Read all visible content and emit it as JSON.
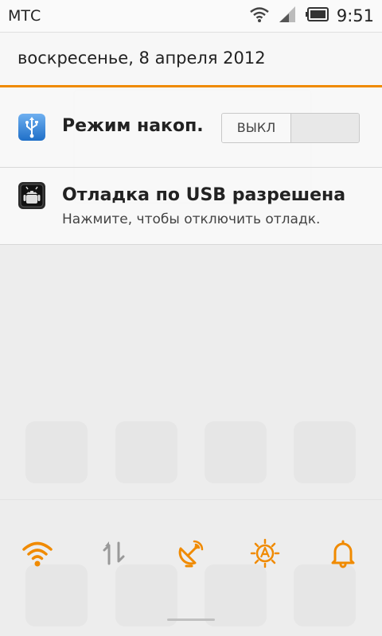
{
  "status_bar": {
    "carrier": "МТС",
    "time": "9:51",
    "icons": [
      "wifi-icon",
      "signal-icon",
      "battery-icon"
    ]
  },
  "shade": {
    "date": "воскресенье, 8 апреля 2012",
    "accent_color": "#f08a00"
  },
  "notifications": [
    {
      "icon": "usb-icon",
      "title": "Режим накоп.",
      "toggle_label": "ВЫКЛ"
    },
    {
      "icon": "android-debug-icon",
      "title": "Отладка по USB разрешена",
      "subtitle": "Нажмите, чтобы отключить отладк."
    }
  ],
  "quick_settings": [
    {
      "icon": "wifi-icon",
      "active": true
    },
    {
      "icon": "data-sync-icon",
      "active": false
    },
    {
      "icon": "gps-icon",
      "active": true
    },
    {
      "icon": "auto-brightness-icon",
      "active": true
    },
    {
      "icon": "bell-icon",
      "active": true
    }
  ]
}
